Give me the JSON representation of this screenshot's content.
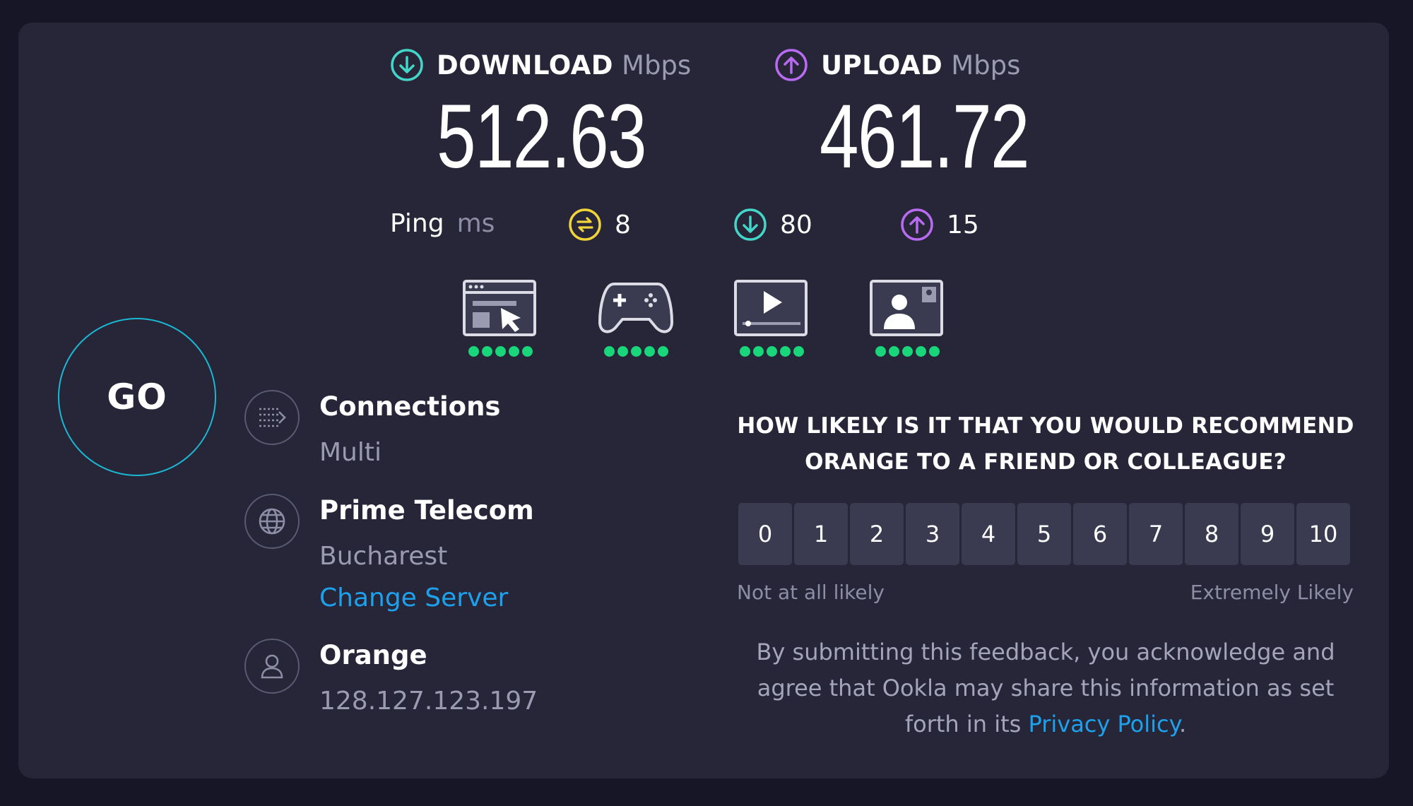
{
  "download": {
    "label": "DOWNLOAD",
    "unit": "Mbps",
    "value": "512.63",
    "icon": "download-arrow-icon",
    "color": "#43d6c8"
  },
  "upload": {
    "label": "UPLOAD",
    "unit": "Mbps",
    "value": "461.72",
    "icon": "upload-arrow-icon",
    "color": "#b86bf0"
  },
  "ping": {
    "label": "Ping",
    "unit": "ms",
    "idle": "8",
    "download": "80",
    "upload": "15",
    "colors": {
      "idle": "#f0d43a",
      "download": "#43d6c8",
      "upload": "#b86bf0"
    }
  },
  "usecases": [
    {
      "icon": "web-browsing-icon",
      "rating": 5
    },
    {
      "icon": "gaming-controller-icon",
      "rating": 5
    },
    {
      "icon": "video-streaming-icon",
      "rating": 5
    },
    {
      "icon": "video-call-icon",
      "rating": 5
    }
  ],
  "go_label": "GO",
  "connections": {
    "title": "Connections",
    "value": "Multi"
  },
  "server": {
    "title": "Prime Telecom",
    "location": "Bucharest",
    "change_label": "Change Server"
  },
  "provider": {
    "title": "Orange",
    "ip": "128.127.123.197"
  },
  "survey": {
    "question_line1": "HOW LIKELY IS IT THAT YOU WOULD RECOMMEND",
    "question_line2": "ORANGE TO A FRIEND OR COLLEAGUE?",
    "scale": [
      "0",
      "1",
      "2",
      "3",
      "4",
      "5",
      "6",
      "7",
      "8",
      "9",
      "10"
    ],
    "low_label": "Not at all likely",
    "high_label": "Extremely Likely",
    "consent_line1": "By submitting this feedback, you acknowledge and",
    "consent_line2": "agree that Ookla may share this information as set",
    "consent_line3_prefix": "forth in its",
    "privacy_link": "Privacy Policy",
    "consent_line3_suffix": "."
  }
}
